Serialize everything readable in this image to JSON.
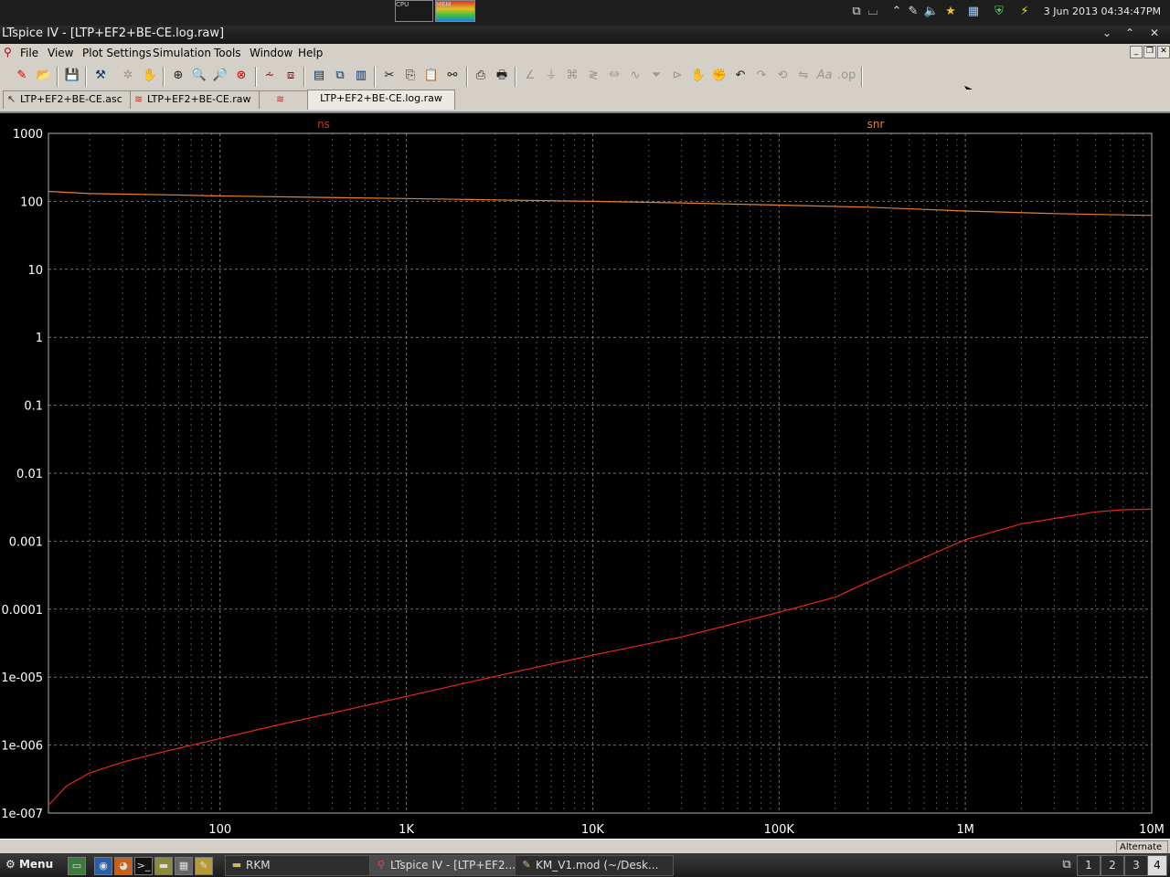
{
  "system_bar": {
    "cpu_label": "CPU",
    "mem_label": "MEM",
    "clock": "3 Jun 2013 04:34:47PM"
  },
  "window": {
    "title": "LTspice IV - [LTP+EF2+BE-CE.log.raw]"
  },
  "menu": {
    "items": [
      "File",
      "View",
      "Plot Settings",
      "Simulation",
      "Tools",
      "Window",
      "Help"
    ]
  },
  "tabs": [
    {
      "label": "LTP+EF2+BE-CE.asc",
      "icon": "schematic-icon"
    },
    {
      "label": "LTP+EF2+BE-CE.raw",
      "icon": "waveform-icon"
    },
    {
      "label": "",
      "icon": "waveform-icon"
    },
    {
      "label": "LTP+EF2+BE-CE.log.raw",
      "icon": ""
    }
  ],
  "chart_data": {
    "type": "line",
    "x_scale": "log",
    "y_scale": "log",
    "xlim": [
      12,
      10000000
    ],
    "ylim": [
      1e-07,
      1000
    ],
    "x_tick_labels": [
      {
        "value": 100,
        "label": "100"
      },
      {
        "value": 1000,
        "label": "1K"
      },
      {
        "value": 10000,
        "label": "10K"
      },
      {
        "value": 100000,
        "label": "100K"
      },
      {
        "value": 1000000,
        "label": "1M"
      },
      {
        "value": 10000000,
        "label": "10M"
      }
    ],
    "y_tick_labels": [
      {
        "value": 1000,
        "label": "1000"
      },
      {
        "value": 100,
        "label": "100"
      },
      {
        "value": 10,
        "label": "10"
      },
      {
        "value": 1,
        "label": "1"
      },
      {
        "value": 0.1,
        "label": "0.1"
      },
      {
        "value": 0.01,
        "label": "0.01"
      },
      {
        "value": 0.001,
        "label": "0.001"
      },
      {
        "value": 0.0001,
        "label": "0.0001"
      },
      {
        "value": 1e-05,
        "label": "1e-005"
      },
      {
        "value": 1e-06,
        "label": "1e-006"
      },
      {
        "value": 1e-07,
        "label": "1e-007"
      }
    ],
    "grid": true,
    "background": "#000000",
    "grid_color": "#808080",
    "series": [
      {
        "name": "ns",
        "color": "#e8261e",
        "x": [
          12,
          15,
          20,
          30,
          50,
          100,
          200,
          500,
          1000,
          2000,
          5000,
          10000,
          30000,
          100000,
          200000,
          300000,
          500000,
          1000000,
          2000000,
          5000000,
          7000000,
          10000000
        ],
        "y": [
          1.3e-07,
          2.5e-07,
          3.9e-07,
          5.6e-07,
          8e-07,
          1.25e-06,
          1.95e-06,
          3.4e-06,
          5.2e-06,
          8e-06,
          1.4e-05,
          2.1e-05,
          3.9e-05,
          9e-05,
          0.00015,
          0.00025,
          0.00046,
          0.00105,
          0.0018,
          0.0027,
          0.0029,
          0.00295
        ]
      },
      {
        "name": "snr",
        "color": "#e8802a",
        "x": [
          12,
          20,
          50,
          100,
          300,
          1000,
          3000,
          10000,
          30000,
          100000,
          300000,
          1000000,
          3000000,
          10000000
        ],
        "y": [
          140,
          130,
          125,
          120,
          115,
          110,
          105,
          100,
          95,
          88,
          82,
          72,
          66,
          62
        ]
      }
    ]
  },
  "status": {
    "right_text": "Alternate"
  },
  "taskbar": {
    "menu_label": "Menu",
    "tasks": [
      {
        "label": "RKM"
      },
      {
        "label": "LTspice IV - [LTP+EF2..."
      },
      {
        "label": "KM_V1.mod (~/Desk..."
      }
    ],
    "desktops": [
      "1",
      "2",
      "3",
      "4"
    ]
  }
}
